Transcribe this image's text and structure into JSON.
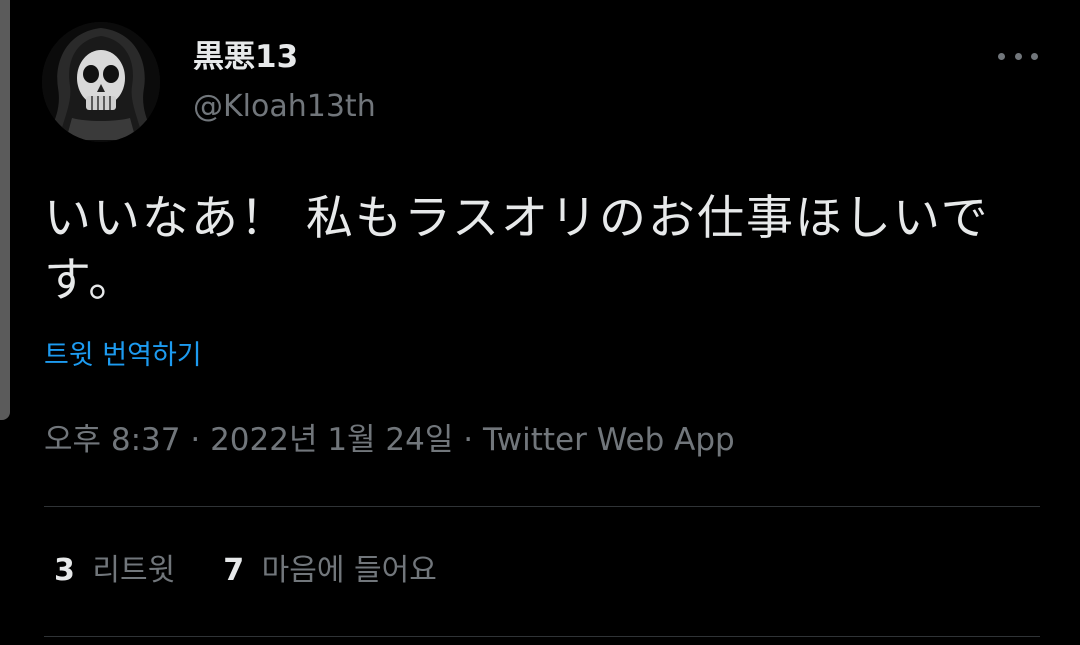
{
  "tweet": {
    "display_name": "黒悪13",
    "handle": "@Kloah13th",
    "text": "いいなあ！ 私もラスオリのお仕事ほしいです。",
    "translate_label": "트윗 번역하기",
    "meta": "오후 8:37 · 2022년 1월 24일 · Twitter Web App",
    "more_icon": "more-horizontal-icon",
    "avatar_icon": "skull-avatar"
  },
  "stats": {
    "retweets_count": "3",
    "retweets_label": "리트윗",
    "likes_count": "7",
    "likes_label": "마음에 들어요"
  },
  "colors": {
    "background": "#000000",
    "primary_text": "#e7e9ea",
    "secondary_text": "#71767b",
    "link": "#1d9bf0",
    "divider": "#2f3336"
  }
}
